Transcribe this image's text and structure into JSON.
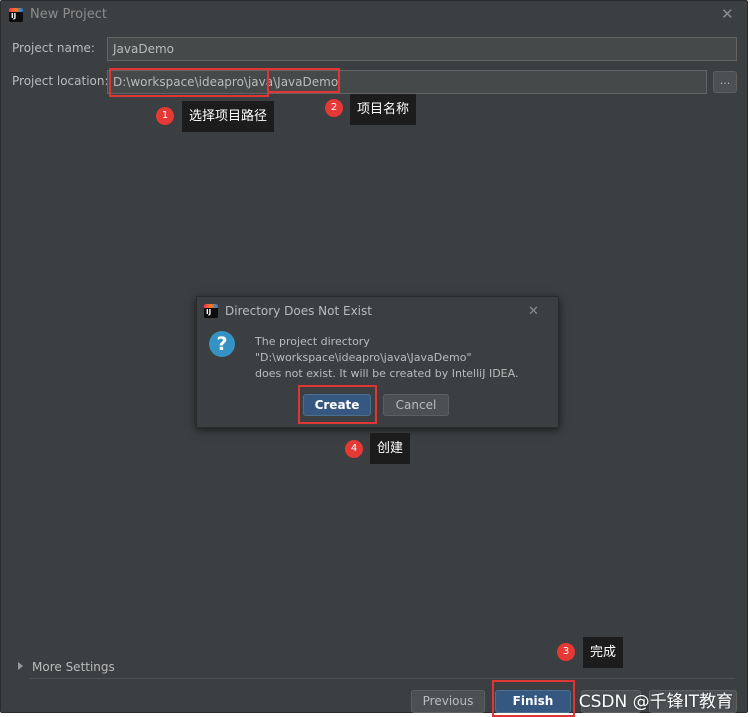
{
  "window": {
    "title": "New Project",
    "app_icon": "intellij-idea-icon",
    "close_icon": "close-icon"
  },
  "form": {
    "name_label": "Project name:",
    "name_value": "JavaDemo",
    "location_label": "Project location:",
    "location_value": "D:\\workspace\\ideapro\\java\\JavaDemo",
    "browse_label": "..."
  },
  "annotations": [
    {
      "number": "1",
      "text": "选择项目路径"
    },
    {
      "number": "2",
      "text": "项目名称"
    },
    {
      "number": "3",
      "text": "完成"
    },
    {
      "number": "4",
      "text": "创建"
    }
  ],
  "dialog": {
    "title": "Directory Does Not Exist",
    "icon": "question-icon",
    "message_lines": [
      "The project directory",
      "\"D:\\workspace\\ideapro\\java\\JavaDemo\"",
      "does not exist. It will be created by IntelliJ IDEA."
    ],
    "create_label": "Create",
    "cancel_label": "Cancel"
  },
  "footer": {
    "more_settings_label": "More Settings",
    "previous_label": "Previous",
    "finish_label": "Finish"
  },
  "watermark": "CSDN @千锋IT教育",
  "colors": {
    "window_bg": "#3c3f41",
    "primary_button": "#365880",
    "annotation_red": "#e53935",
    "tooltip_bg": "#1c1c1c"
  }
}
